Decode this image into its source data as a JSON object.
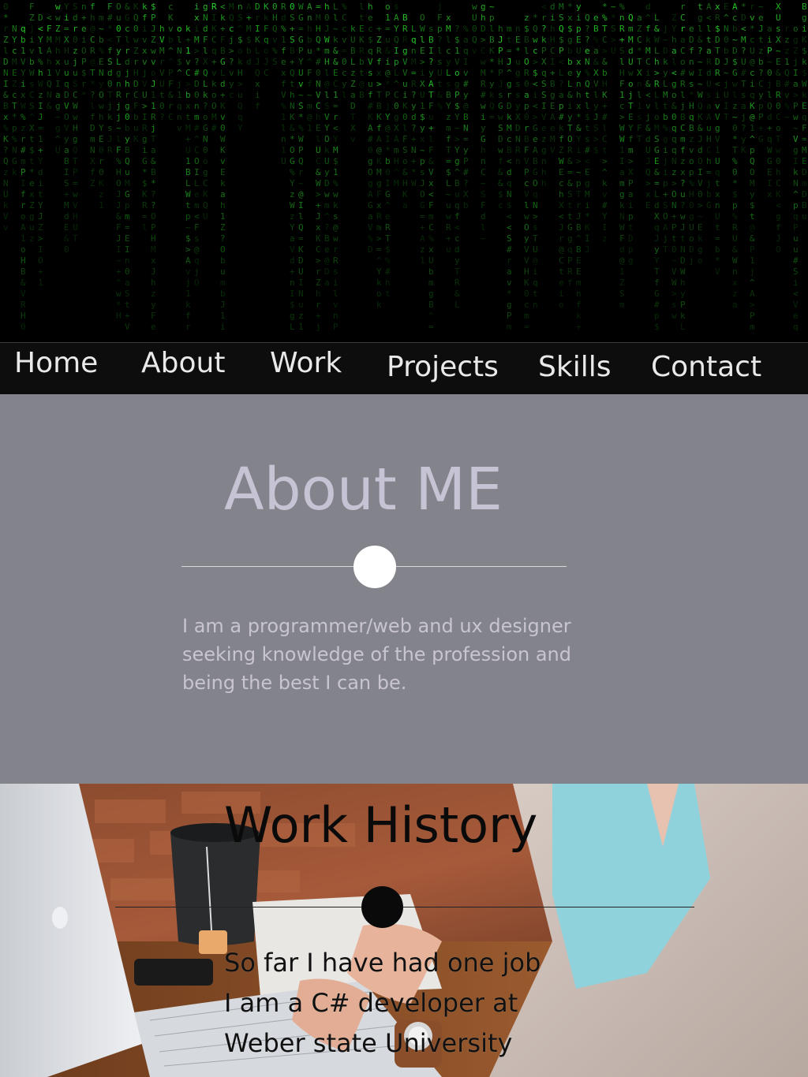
{
  "nav": {
    "items": [
      {
        "label": "Home"
      },
      {
        "label": "About"
      },
      {
        "label": "Work"
      },
      {
        "label": "Projects"
      },
      {
        "label": "Skills"
      },
      {
        "label": "Contact"
      }
    ]
  },
  "about": {
    "title": "About ME",
    "description": "I am a programmer/web and ux designer seeking knowledge of the profession and being the best I can be."
  },
  "work": {
    "title": "Work History",
    "lines": [
      "So far I have had one job",
      "I am a C# developer at",
      "Weber state University"
    ]
  },
  "colors": {
    "nav_bg": "#0d0d0d",
    "about_bg": "#83838b",
    "about_title": "#c6c3d4",
    "matrix_green": "#2bdc2b"
  }
}
